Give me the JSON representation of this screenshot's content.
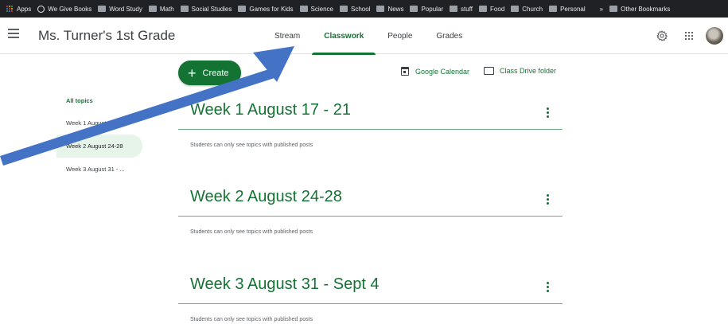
{
  "bookmarks": [
    {
      "label": "Apps",
      "icon": "apps-icon"
    },
    {
      "label": "We Give Books",
      "icon": "globe-icon"
    },
    {
      "label": "Word Study",
      "icon": "folder-icon"
    },
    {
      "label": "Math",
      "icon": "folder-icon"
    },
    {
      "label": "Social Studies",
      "icon": "folder-icon"
    },
    {
      "label": "Games for Kids",
      "icon": "folder-icon"
    },
    {
      "label": "Science",
      "icon": "folder-icon"
    },
    {
      "label": "School",
      "icon": "folder-icon"
    },
    {
      "label": "News",
      "icon": "folder-icon"
    },
    {
      "label": "Popular",
      "icon": "folder-icon"
    },
    {
      "label": "stuff",
      "icon": "folder-icon"
    },
    {
      "label": "Food",
      "icon": "folder-icon"
    },
    {
      "label": "Church",
      "icon": "folder-icon"
    },
    {
      "label": "Personal",
      "icon": "folder-icon"
    }
  ],
  "bookmarks_overflow": "»",
  "other_bookmarks": "Other Bookmarks",
  "header": {
    "class_title": "Ms. Turner's 1st Grade",
    "tabs": [
      {
        "label": "Stream",
        "active": false
      },
      {
        "label": "Classwork",
        "active": true
      },
      {
        "label": "People",
        "active": false
      },
      {
        "label": "Grades",
        "active": false
      }
    ]
  },
  "toolbar": {
    "create_label": "Create",
    "calendar_label": "Google Calendar",
    "drive_label": "Class Drive folder"
  },
  "sidebar": {
    "all_topics": "All topics",
    "items": [
      {
        "label": "Week 1 August 17 - ...",
        "selected": false
      },
      {
        "label": "Week 2 August 24-28",
        "selected": true
      },
      {
        "label": "Week 3 August 31 - ...",
        "selected": false
      }
    ]
  },
  "topics": [
    {
      "title": "Week 1 August 17 - 21",
      "note": "Students can only see topics with published posts"
    },
    {
      "title": "Week 2 August 24-28",
      "note": "Students can only see topics with published posts"
    },
    {
      "title": "Week 3 August 31 - Sept 4",
      "note": "Students can only see topics with published posts"
    }
  ],
  "colors": {
    "accent": "#137333",
    "arrow": "#4472c4",
    "bookmarks_bg": "#202124"
  }
}
